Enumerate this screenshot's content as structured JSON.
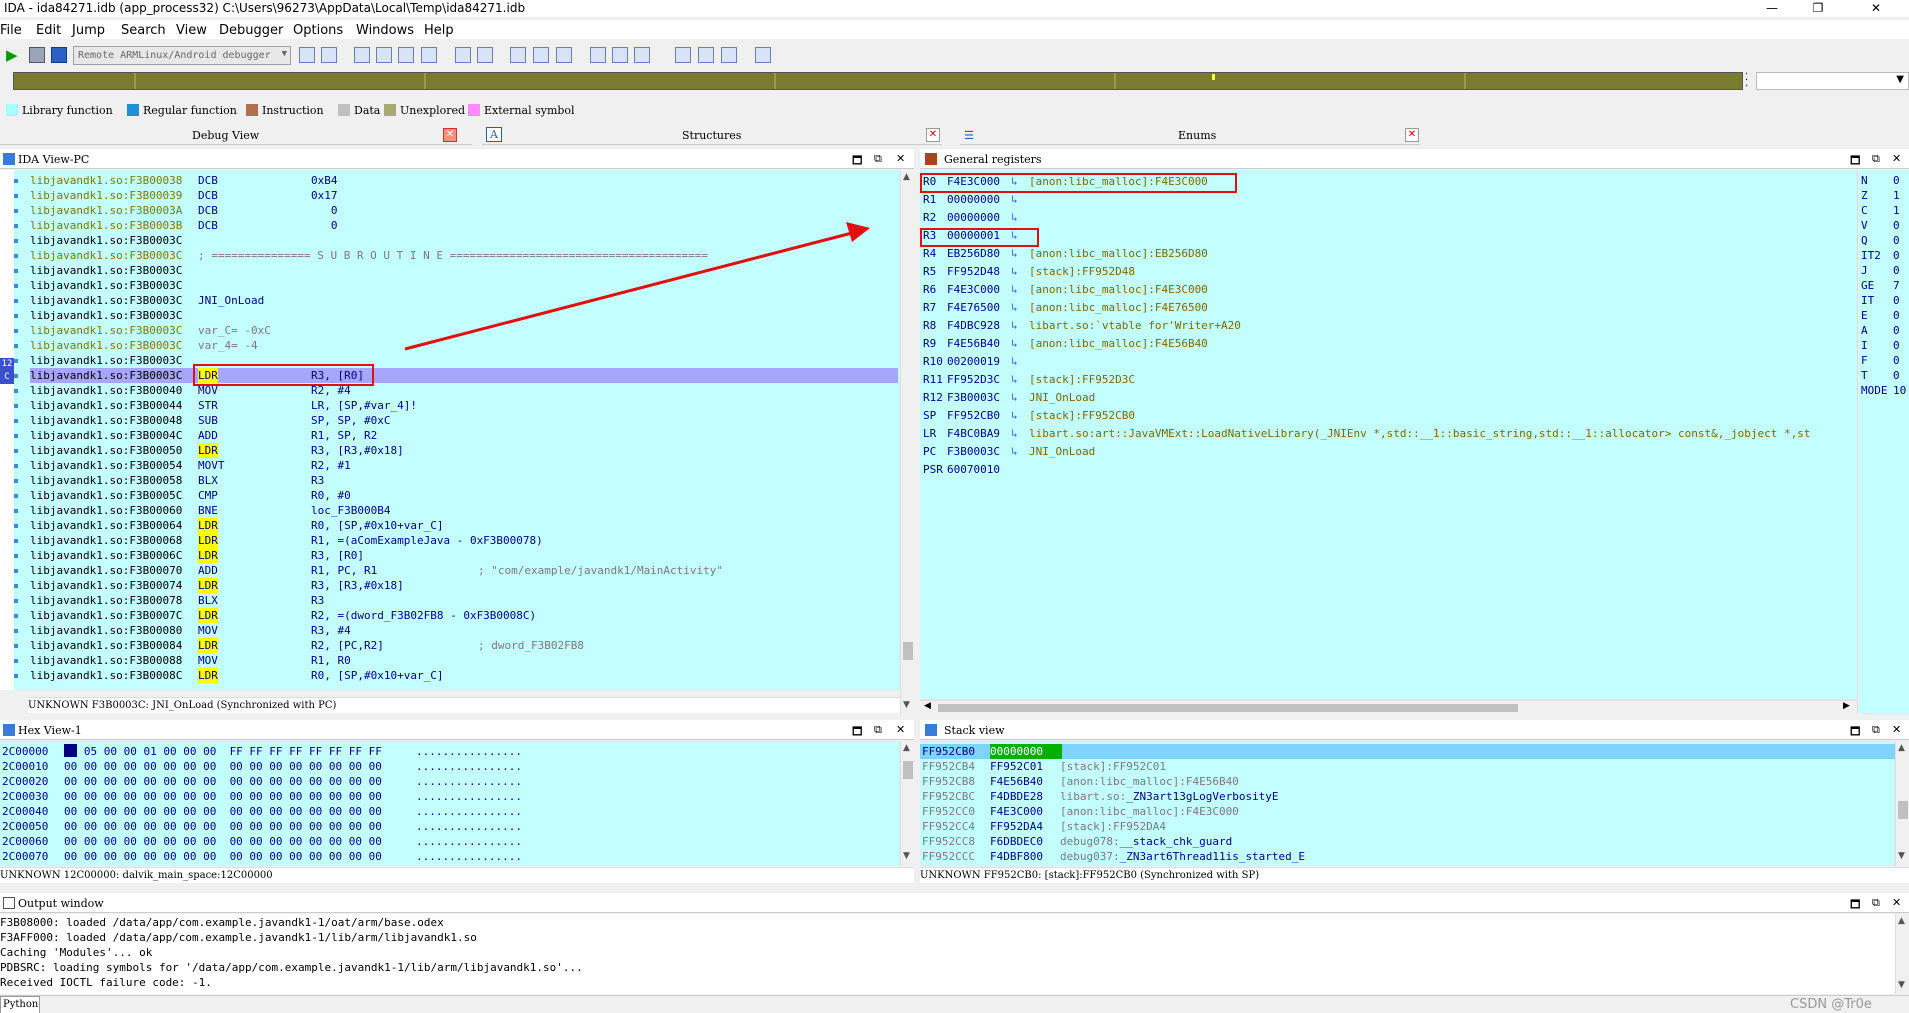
{
  "titlebar": {
    "title": "IDA - ida84271.idb (app_process32) C:\\Users\\96273\\AppData\\Local\\Temp\\ida84271.idb",
    "minimize": "—",
    "maximize": "❐",
    "close": "✕"
  },
  "menu": [
    "File",
    "Edit",
    "Jump",
    "Search",
    "View",
    "Debugger",
    "Options",
    "Windows",
    "Help"
  ],
  "toolbar": {
    "debugger_select": "Remote ARMLinux/Android debugger"
  },
  "legend": [
    {
      "label": "Library function",
      "color": "#a6ffff"
    },
    {
      "label": "Regular function",
      "color": "#1f8fd8"
    },
    {
      "label": "Instruction",
      "color": "#b07050"
    },
    {
      "label": "Data",
      "color": "#c0c0c0"
    },
    {
      "label": "Unexplored",
      "color": "#a8a870"
    },
    {
      "label": "External symbol",
      "color": "#ff88ff"
    }
  ],
  "tabs": {
    "debug_view": "Debug View",
    "structures": "Structures",
    "enums": "Enums",
    "structures_icon": "A",
    "enums_icon": "☰"
  },
  "ida_view": {
    "title": "IDA View-PC",
    "margin_marker": "12\nC",
    "lines": [
      {
        "addr": "libjavandk1.so:F3B00038",
        "mn": "DCB",
        "op": "0xB4",
        "gray": true
      },
      {
        "addr": "libjavandk1.so:F3B00039",
        "mn": "DCB",
        "op": "0x17",
        "gray": true
      },
      {
        "addr": "libjavandk1.so:F3B0003A",
        "mn": "DCB",
        "op": "   0",
        "gray": true
      },
      {
        "addr": "libjavandk1.so:F3B0003B",
        "mn": "DCB",
        "op": "   0",
        "gray": true
      },
      {
        "addr": "libjavandk1.so:F3B0003C",
        "mn": "",
        "op": ""
      },
      {
        "addr": "libjavandk1.so:F3B0003C",
        "full": "; =============== S U B R O U T I N E =======================================",
        "gray": true
      },
      {
        "addr": "libjavandk1.so:F3B0003C",
        "mn": "",
        "op": ""
      },
      {
        "addr": "libjavandk1.so:F3B0003C",
        "mn": "",
        "op": ""
      },
      {
        "addr": "libjavandk1.so:F3B0003C",
        "full": "JNI_OnLoad"
      },
      {
        "addr": "libjavandk1.so:F3B0003C",
        "mn": "",
        "op": ""
      },
      {
        "addr": "libjavandk1.so:F3B0003C",
        "full": "var_C= -0xC",
        "gray": true
      },
      {
        "addr": "libjavandk1.so:F3B0003C",
        "full": "var_4= -4",
        "gray": true
      },
      {
        "addr": "libjavandk1.so:F3B0003C",
        "mn": "",
        "op": ""
      },
      {
        "addr": "libjavandk1.so:F3B0003C",
        "mn": "LDR",
        "op": "R3, [R0]",
        "current": true,
        "hl": true
      },
      {
        "addr": "libjavandk1.so:F3B00040",
        "mn": "MOV",
        "op": "R2, #4"
      },
      {
        "addr": "libjavandk1.so:F3B00044",
        "mn": "STR",
        "op": "LR, [SP,#var_4]!"
      },
      {
        "addr": "libjavandk1.so:F3B00048",
        "mn": "SUB",
        "op": "SP, SP, #0xC"
      },
      {
        "addr": "libjavandk1.so:F3B0004C",
        "mn": "ADD",
        "op": "R1, SP, R2"
      },
      {
        "addr": "libjavandk1.so:F3B00050",
        "mn": "LDR",
        "op": "R3, [R3,#0x18]",
        "hl": true
      },
      {
        "addr": "libjavandk1.so:F3B00054",
        "mn": "MOVT",
        "op": "R2, #1"
      },
      {
        "addr": "libjavandk1.so:F3B00058",
        "mn": "BLX",
        "op": "R3"
      },
      {
        "addr": "libjavandk1.so:F3B0005C",
        "mn": "CMP",
        "op": "R0, #0"
      },
      {
        "addr": "libjavandk1.so:F3B00060",
        "mn": "BNE",
        "op": "loc_F3B000B4"
      },
      {
        "addr": "libjavandk1.so:F3B00064",
        "mn": "LDR",
        "op": "R0, [SP,#0x10+var_C]",
        "hl": true
      },
      {
        "addr": "libjavandk1.so:F3B00068",
        "mn": "LDR",
        "op": "R1, =(aComExampleJava - 0xF3B00078)",
        "hl": true
      },
      {
        "addr": "libjavandk1.so:F3B0006C",
        "mn": "LDR",
        "op": "R3, [R0]",
        "hl": true
      },
      {
        "addr": "libjavandk1.so:F3B00070",
        "mn": "ADD",
        "op": "R1, PC, R1",
        "cm": "; \"com/example/javandk1/MainActivity\""
      },
      {
        "addr": "libjavandk1.so:F3B00074",
        "mn": "LDR",
        "op": "R3, [R3,#0x18]",
        "hl": true
      },
      {
        "addr": "libjavandk1.so:F3B00078",
        "mn": "BLX",
        "op": "R3"
      },
      {
        "addr": "libjavandk1.so:F3B0007C",
        "mn": "LDR",
        "op": "R2, =(dword_F3B02FB8 - 0xF3B0008C)",
        "hl": true
      },
      {
        "addr": "libjavandk1.so:F3B00080",
        "mn": "MOV",
        "op": "R3, #4"
      },
      {
        "addr": "libjavandk1.so:F3B00084",
        "mn": "LDR",
        "op": "R2, [PC,R2]",
        "hl": true,
        "cm": "; dword_F3B02FB8"
      },
      {
        "addr": "libjavandk1.so:F3B00088",
        "mn": "MOV",
        "op": "R1, R0"
      },
      {
        "addr": "libjavandk1.so:F3B0008C",
        "mn": "LDR",
        "op": "R0, [SP,#0x10+var_C]",
        "hl": true
      }
    ],
    "status": "UNKNOWN F3B0003C: JNI_OnLoad (Synchronized with PC)"
  },
  "registers": {
    "title": "General registers",
    "rows": [
      {
        "name": "R0",
        "value": "F4E3C000",
        "arrow": "↳",
        "desc": "[anon:libc_malloc]:F4E3C000"
      },
      {
        "name": "R1",
        "value": "00000000",
        "arrow": "↳",
        "desc": ""
      },
      {
        "name": "R2",
        "value": "00000000",
        "arrow": "↳",
        "desc": ""
      },
      {
        "name": "R3",
        "value": "00000001",
        "arrow": "↳",
        "desc": ""
      },
      {
        "name": "R4",
        "value": "EB256D80",
        "arrow": "↳",
        "desc": "[anon:libc_malloc]:EB256D80"
      },
      {
        "name": "R5",
        "value": "FF952D48",
        "arrow": "↳",
        "desc": "[stack]:FF952D48"
      },
      {
        "name": "R6",
        "value": "F4E3C000",
        "arrow": "↳",
        "desc": "[anon:libc_malloc]:F4E3C000"
      },
      {
        "name": "R7",
        "value": "F4E76500",
        "arrow": "↳",
        "desc": "[anon:libc_malloc]:F4E76500"
      },
      {
        "name": "R8",
        "value": "F4DBC928",
        "arrow": "↳",
        "desc": "libart.so:`vtable for'Writer+A20"
      },
      {
        "name": "R9",
        "value": "F4E56B40",
        "arrow": "↳",
        "desc": "[anon:libc_malloc]:F4E56B40"
      },
      {
        "name": "R10",
        "value": "00200019",
        "arrow": "↳",
        "desc": ""
      },
      {
        "name": "R11",
        "value": "FF952D3C",
        "arrow": "↳",
        "desc": "[stack]:FF952D3C"
      },
      {
        "name": "R12",
        "value": "F3B0003C",
        "arrow": "↳",
        "desc": "JNI_OnLoad"
      },
      {
        "name": "SP",
        "value": "FF952CB0",
        "arrow": "↳",
        "desc": "[stack]:FF952CB0"
      },
      {
        "name": "LR",
        "value": "F4BC0BA9",
        "arrow": "↳",
        "desc": "libart.so:art::JavaVMExt::LoadNativeLibrary(_JNIEnv *,std::__1::basic_string,std::__1::allocator> const&,_jobject *,st"
      },
      {
        "name": "PC",
        "value": "F3B0003C",
        "arrow": "↳",
        "desc": "JNI_OnLoad"
      },
      {
        "name": "PSR",
        "value": "60070010",
        "arrow": "",
        "desc": ""
      }
    ],
    "flags": [
      {
        "name": "N",
        "value": "0"
      },
      {
        "name": "Z",
        "value": "1"
      },
      {
        "name": "C",
        "value": "1"
      },
      {
        "name": "V",
        "value": "0"
      },
      {
        "name": "Q",
        "value": "0"
      },
      {
        "name": "IT2",
        "value": "0"
      },
      {
        "name": "J",
        "value": "0"
      },
      {
        "name": "GE",
        "value": "7"
      },
      {
        "name": "IT",
        "value": "0"
      },
      {
        "name": "E",
        "value": "0"
      },
      {
        "name": "A",
        "value": "0"
      },
      {
        "name": "I",
        "value": "0"
      },
      {
        "name": "F",
        "value": "0"
      },
      {
        "name": "T",
        "value": "0"
      },
      {
        "name": "MODE",
        "value": "10"
      }
    ]
  },
  "hex_view": {
    "title": "Hex View-1",
    "lines": [
      {
        "addr": "2C00000",
        "bytes": "00 05 00 00 01 00 00 00  FF FF FF FF FF FF FF FF",
        "ascii": "................"
      },
      {
        "addr": "2C00010",
        "bytes": "00 00 00 00 00 00 00 00  00 00 00 00 00 00 00 00",
        "ascii": "................"
      },
      {
        "addr": "2C00020",
        "bytes": "00 00 00 00 00 00 00 00  00 00 00 00 00 00 00 00",
        "ascii": "................"
      },
      {
        "addr": "2C00030",
        "bytes": "00 00 00 00 00 00 00 00  00 00 00 00 00 00 00 00",
        "ascii": "................"
      },
      {
        "addr": "2C00040",
        "bytes": "00 00 00 00 00 00 00 00  00 00 00 00 00 00 00 00",
        "ascii": "................"
      },
      {
        "addr": "2C00050",
        "bytes": "00 00 00 00 00 00 00 00  00 00 00 00 00 00 00 00",
        "ascii": "................"
      },
      {
        "addr": "2C00060",
        "bytes": "00 00 00 00 00 00 00 00  00 00 00 00 00 00 00 00",
        "ascii": "................"
      },
      {
        "addr": "2C00070",
        "bytes": "00 00 00 00 00 00 00 00  00 00 00 00 00 00 00 00",
        "ascii": "................"
      }
    ],
    "status": "UNKNOWN 12C00000: dalvik_main_space:12C00000"
  },
  "stack_view": {
    "title": "Stack view",
    "lines": [
      {
        "addr": "FF952CB0",
        "value": "00000000",
        "desc": "",
        "current": true
      },
      {
        "addr": "FF952CB4",
        "value": "FF952C01",
        "desc": "[stack]:FF952C01"
      },
      {
        "addr": "FF952CB8",
        "value": "F4E56B40",
        "desc": "[anon:libc_malloc]:F4E56B40"
      },
      {
        "addr": "FF952CBC",
        "value": "F4DBDE28",
        "desc": "libart.so:",
        "sym": "_ZN3art13gLogVerbosityE"
      },
      {
        "addr": "FF952CC0",
        "value": "F4E3C000",
        "desc": "[anon:libc_malloc]:F4E3C000"
      },
      {
        "addr": "FF952CC4",
        "value": "FF952DA4",
        "desc": "[stack]:FF952DA4"
      },
      {
        "addr": "FF952CC8",
        "value": "F6DBDEC0",
        "desc": "debug078:",
        "sym": "__stack_chk_guard"
      },
      {
        "addr": "FF952CCC",
        "value": "F4DBF800",
        "desc": "debug037:",
        "sym": "_ZN3art6Thread11is_started_E"
      }
    ],
    "status": "UNKNOWN FF952CB0: [stack]:FF952CB0 (Synchronized with SP)"
  },
  "output": {
    "title": "Output window",
    "lines": [
      "F3B08000: loaded /data/app/com.example.javandk1-1/oat/arm/base.odex",
      "F3AFF000: loaded /data/app/com.example.javandk1-1/lib/arm/libjavandk1.so",
      "Caching 'Modules'... ok",
      "PDBSRC: loading symbols for '/data/app/com.example.javandk1-1/lib/arm/libjavandk1.so'...",
      "Received IOCTL failure code: -1."
    ],
    "python_tab": "Python"
  },
  "watermark": "CSDN @Tr0e"
}
